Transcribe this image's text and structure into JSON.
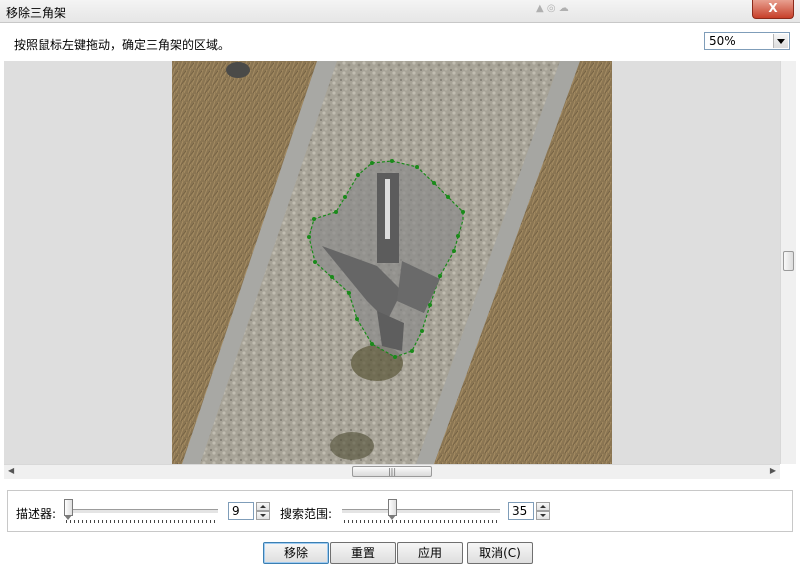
{
  "window": {
    "title": "移除三角架",
    "close_label": "X"
  },
  "instruction": "按照鼠标左键拖动，确定三角架的区域。",
  "zoom": {
    "value": "50%"
  },
  "controls": {
    "descriptor_label": "描述器:",
    "descriptor_value": "9",
    "search_range_label": "搜索范围:",
    "search_range_value": "35"
  },
  "buttons": {
    "remove": "移除",
    "reset": "重置",
    "apply": "应用",
    "cancel": "取消(C)"
  },
  "colors": {
    "selection_outline": "#1a8a1a",
    "selection_fill": "#8a8a8a",
    "viewport_bg": "#dedede"
  }
}
